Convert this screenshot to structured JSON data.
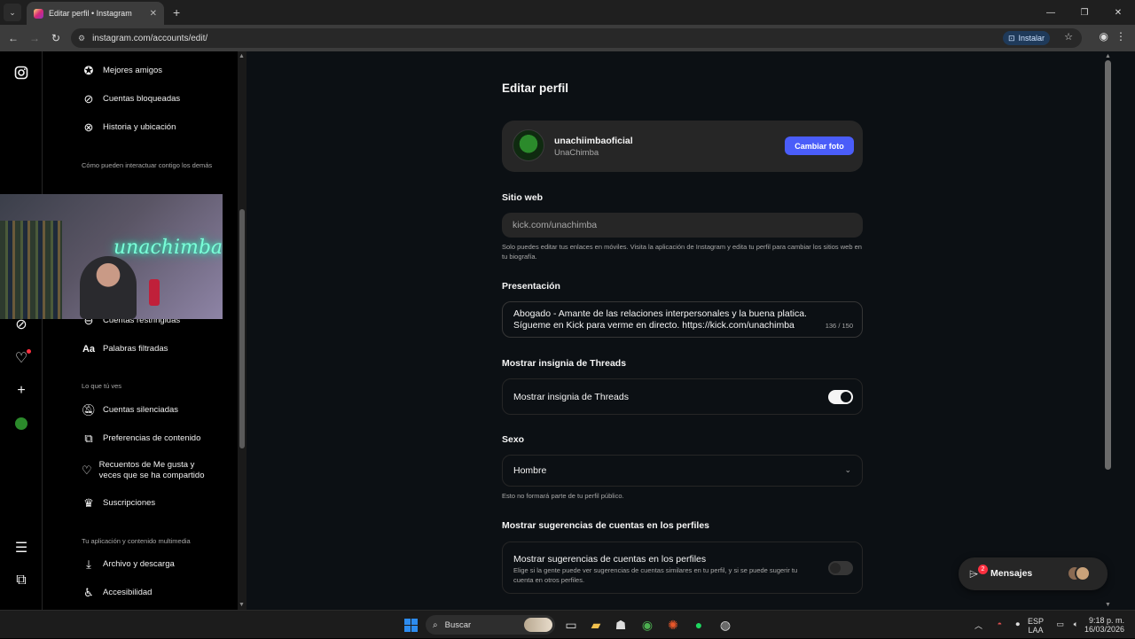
{
  "browser": {
    "tab_title": "Editar perfil • Instagram",
    "url": "instagram.com/accounts/edit/",
    "install_label": "Instalar"
  },
  "settings_nav": {
    "items_top": [
      {
        "label": "Mejores amigos",
        "icon": "star-circle-icon"
      },
      {
        "label": "Cuentas bloqueadas",
        "icon": "blocked-icon"
      },
      {
        "label": "Historia y ubicación",
        "icon": "story-location-off-icon"
      }
    ],
    "section_interact": "Cómo pueden interactuar contigo los demás",
    "items_interact": [
      {
        "label": "Cuentas restringidas",
        "icon": "restricted-icon"
      },
      {
        "label": "Palabras filtradas",
        "icon": "text-aa-icon"
      }
    ],
    "section_see": "Lo que tú ves",
    "items_see": [
      {
        "label": "Cuentas silenciadas",
        "icon": "muted-bell-icon"
      },
      {
        "label": "Preferencias de contenido",
        "icon": "content-preferences-icon"
      },
      {
        "label": "Recuentos de Me gusta y veces que se ha compartido",
        "icon": "hidden-likes-icon"
      },
      {
        "label": "Suscripciones",
        "icon": "crown-icon"
      }
    ],
    "section_media": "Tu aplicación y contenido multimedia",
    "items_media": [
      {
        "label": "Archivo y descarga",
        "icon": "download-icon"
      },
      {
        "label": "Accesibilidad",
        "icon": "accessibility-icon"
      }
    ]
  },
  "webcam_overlay": {
    "neon_text": "unachimba"
  },
  "edit_profile": {
    "title": "Editar perfil",
    "username": "unachiimbaoficial",
    "full_name": "UnaChimba",
    "change_photo": "Cambiar foto",
    "website_label": "Sitio web",
    "website_value": "kick.com/unachimba",
    "website_help": "Solo puedes editar tus enlaces en móviles. Visita la aplicación de Instagram y edita tu perfil para cambiar los sitios web en tu biografía.",
    "bio_label": "Presentación",
    "bio_line1": "Abogado - Amante de las relaciones interpersonales y la buena platica.",
    "bio_line2": "Sígueme en Kick para verme en directo. https://kick.com/unachimba",
    "bio_count": "136 / 150",
    "threads_label": "Mostrar insignia de Threads",
    "threads_toggle_label": "Mostrar insignia de Threads",
    "threads_toggle_on": true,
    "gender_label": "Sexo",
    "gender_value": "Hombre",
    "gender_help": "Esto no formará parte de tu perfil público.",
    "suggestions_label": "Mostrar sugerencias de cuentas en los perfiles",
    "suggestions_toggle_label": "Mostrar sugerencias de cuentas en los perfiles",
    "suggestions_desc": "Elige si la gente puede ver sugerencias de cuentas similares en tu perfil, y si se puede sugerir tu cuenta en otros perfiles.",
    "suggestions_toggle_on": false
  },
  "messages": {
    "label": "Mensajes",
    "badge": "2"
  },
  "taskbar": {
    "search_placeholder": "Buscar",
    "lang_top": "ESP",
    "lang_bottom": "LAA",
    "time": "9:18 p. m.",
    "date": "16/03/2026"
  },
  "colors": {
    "accent": "#4a5df9",
    "background": "#0c1014",
    "card": "#262626",
    "notification": "#ff3040"
  }
}
